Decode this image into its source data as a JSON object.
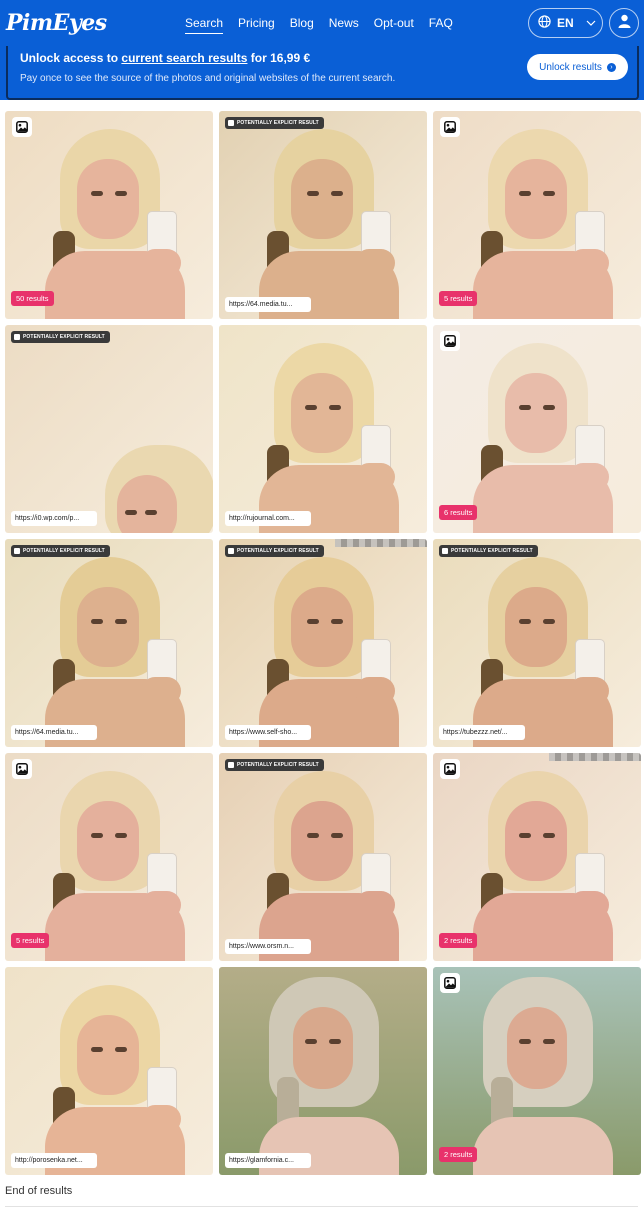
{
  "header": {
    "logo": "PimEyes",
    "nav": [
      "Search",
      "Pricing",
      "Blog",
      "News",
      "Opt-out",
      "FAQ"
    ],
    "active_nav": "Search",
    "language": "EN",
    "icons": {
      "language": "globe-icon",
      "user": "user-icon"
    }
  },
  "banner": {
    "title_prefix": "Unlock access to ",
    "title_link": "current search results",
    "title_suffix": " for 16,99 €",
    "subtitle": "Pay once to see the source of the photos and original websites of the current search.",
    "button_label": "Unlock results"
  },
  "labels": {
    "explicit": "POTENTIALLY EXPLICIT RESULT"
  },
  "colors": {
    "brand_blue": "#0a5fd6",
    "results_badge": "#e8326b"
  },
  "results": [
    {
      "top_icon": "image",
      "count": "50 results",
      "url": ""
    },
    {
      "top_icon": "explicit",
      "count": "",
      "url": "https://64.media.tu..."
    },
    {
      "top_icon": "image",
      "count": "5 results",
      "url": ""
    },
    {
      "top_icon": "explicit",
      "count": "",
      "url": "https://i0.wp.com/p..."
    },
    {
      "top_icon": "",
      "count": "",
      "url": "http://rujournal.com..."
    },
    {
      "top_icon": "image",
      "count": "6 results",
      "url": ""
    },
    {
      "top_icon": "explicit",
      "count": "",
      "url": "https://64.media.tu..."
    },
    {
      "top_icon": "explicit",
      "count": "",
      "url": "https://www.self-sho..."
    },
    {
      "top_icon": "explicit",
      "count": "",
      "url": "https://tubezzz.net/..."
    },
    {
      "top_icon": "image",
      "count": "5 results",
      "url": ""
    },
    {
      "top_icon": "explicit",
      "count": "",
      "url": "https://www.orsm.n..."
    },
    {
      "top_icon": "image",
      "count": "2 results",
      "url": ""
    },
    {
      "top_icon": "",
      "count": "",
      "url": "http://porosenka.net..."
    },
    {
      "top_icon": "",
      "count": "",
      "url": "https://glamfornia.c..."
    },
    {
      "top_icon": "image",
      "count": "2 results",
      "url": ""
    }
  ],
  "footer": {
    "end_text": "End of results"
  }
}
